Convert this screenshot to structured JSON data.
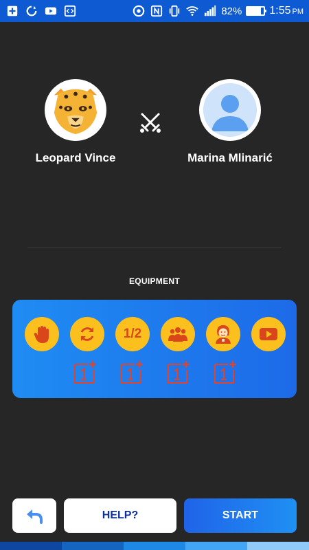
{
  "status_bar": {
    "battery_percent": "82%",
    "battery_level": 0.82,
    "time": "1:55",
    "ampm": "PM",
    "left_icons": [
      "add-box-icon",
      "sync-icon",
      "youtube-icon",
      "code-icon"
    ],
    "right_icons": [
      "beats-icon",
      "nfc-icon",
      "vibrate-icon",
      "wifi-icon",
      "signal-icon",
      "battery-icon"
    ]
  },
  "players": {
    "left_name": "Leopard Vince",
    "right_name": "Marina Mlinarić",
    "left_avatar": "leopard-avatar",
    "right_avatar": "default-user-avatar",
    "versus_icon": "crossed-swords-icon"
  },
  "equipment": {
    "title": "EQUIPMENT",
    "items": [
      {
        "icon": "hand-stop-icon"
      },
      {
        "icon": "refresh-icon"
      },
      {
        "icon": "half-icon",
        "label": "1/2"
      },
      {
        "icon": "audience-icon"
      },
      {
        "icon": "person-icon"
      },
      {
        "icon": "play-video-icon"
      }
    ],
    "plus_one_slots": 4,
    "colors": {
      "button": "#fcc01e",
      "icon": "#d9461c",
      "panel_start": "#1f8cf3",
      "panel_end": "#1d6ae8"
    }
  },
  "actions": {
    "back_icon": "back-arrow-icon",
    "help_label": "HELP?",
    "start_label": "START"
  }
}
